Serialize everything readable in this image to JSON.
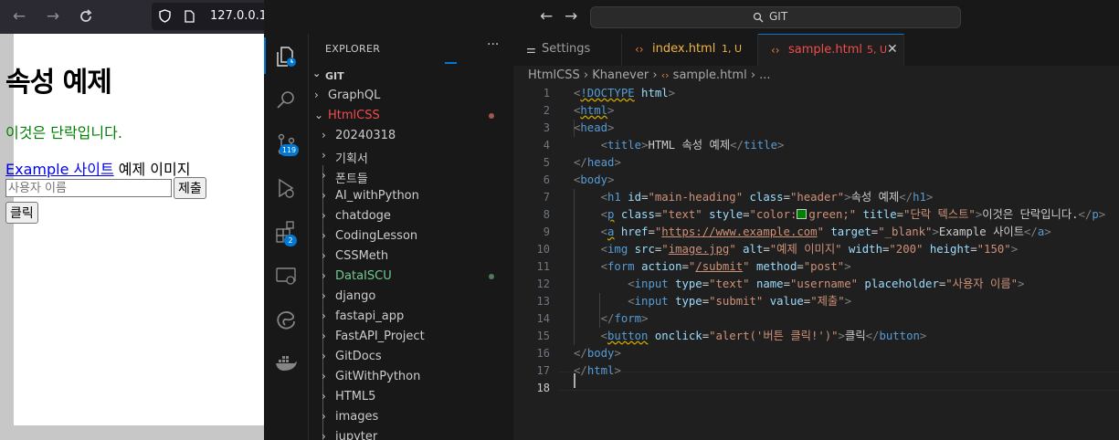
{
  "browser": {
    "url": "127.0.0.1",
    "page": {
      "heading": "속성 예제",
      "paragraph": "이것은 단락입니다.",
      "link_text": "Example 사이트",
      "image_alt": "예제 이미지",
      "input_placeholder": "사용자 이름",
      "submit_label": "제출",
      "button_label": "클릭"
    }
  },
  "vscode": {
    "command_center": "GIT",
    "explorer": {
      "title": "EXPLORER",
      "more": "···",
      "root": "GIT",
      "items": [
        {
          "label": "GraphQL",
          "level": 0,
          "expanded": false,
          "color": "#cccccc"
        },
        {
          "label": "HtmlCSS",
          "level": 0,
          "expanded": true,
          "color": "#f14c4c",
          "dot": "#9e5a4f"
        },
        {
          "label": "20240318",
          "level": 1,
          "expanded": false,
          "color": "#cccccc"
        },
        {
          "label": "기획서",
          "level": 1,
          "expanded": false,
          "color": "#cccccc"
        },
        {
          "label": "폰트들",
          "level": 1,
          "expanded": false,
          "color": "#cccccc"
        },
        {
          "label": "AI_withPython",
          "level": 1,
          "expanded": false,
          "color": "#cccccc"
        },
        {
          "label": "chatdoge",
          "level": 1,
          "expanded": false,
          "color": "#cccccc"
        },
        {
          "label": "CodingLesson",
          "level": 1,
          "expanded": false,
          "color": "#cccccc"
        },
        {
          "label": "CSSMeth",
          "level": 1,
          "expanded": false,
          "color": "#cccccc"
        },
        {
          "label": "DataISCU",
          "level": 1,
          "expanded": false,
          "color": "#73c991",
          "dot": "#4e7a5a"
        },
        {
          "label": "django",
          "level": 1,
          "expanded": false,
          "color": "#cccccc"
        },
        {
          "label": "fastapi_app",
          "level": 1,
          "expanded": false,
          "color": "#cccccc"
        },
        {
          "label": "FastAPI_Project",
          "level": 1,
          "expanded": false,
          "color": "#cccccc"
        },
        {
          "label": "GitDocs",
          "level": 1,
          "expanded": false,
          "color": "#cccccc"
        },
        {
          "label": "GitWithPython",
          "level": 1,
          "expanded": false,
          "color": "#cccccc"
        },
        {
          "label": "HTML5",
          "level": 1,
          "expanded": false,
          "color": "#cccccc"
        },
        {
          "label": "images",
          "level": 1,
          "expanded": false,
          "color": "#cccccc"
        },
        {
          "label": "jupyter",
          "level": 1,
          "expanded": false,
          "color": "#cccccc"
        }
      ]
    },
    "badges": {
      "source_control": "119",
      "extensions": "2"
    },
    "tabs": [
      {
        "label": "Settings",
        "status": "",
        "active": false
      },
      {
        "label": "index.html",
        "status": "1, U",
        "active": false
      },
      {
        "label": "sample.html",
        "status": "5, U",
        "active": true
      }
    ],
    "breadcrumb": [
      "HtmlCSS",
      "Khanever",
      "sample.html",
      "..."
    ],
    "line_numbers": [
      "1",
      "2",
      "3",
      "4",
      "5",
      "6",
      "7",
      "8",
      "9",
      "10",
      "11",
      "12",
      "13",
      "14",
      "15",
      "16",
      "17",
      "18"
    ]
  },
  "colors": {
    "accent": "#0078d4",
    "modified": "#f14c4c",
    "untracked": "#73c991",
    "tag": "#569cd6",
    "attribute": "#9cdcfe",
    "string": "#ce9178"
  }
}
